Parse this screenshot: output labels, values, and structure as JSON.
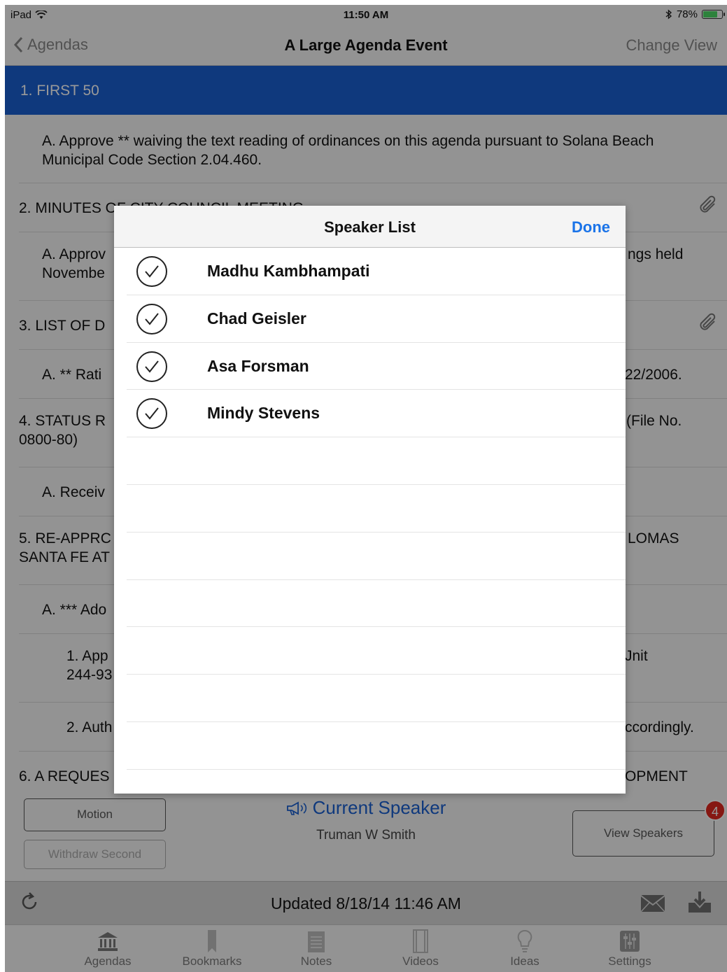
{
  "status_bar": {
    "device": "iPad",
    "time": "11:50 AM",
    "battery": "78%",
    "battery_level": 0.78
  },
  "nav": {
    "back_label": "Agendas",
    "title": "A Large Agenda Event",
    "right_label": "Change View"
  },
  "agenda": {
    "section": "1. FIRST 50",
    "rows": [
      {
        "text": "A. Approve ** waiving the text reading of ordinances on this agenda pursuant to Solana Beach Municipal Code Section 2.04.460."
      },
      {
        "text": "2. MINUTES OF CITY COUNCIL MEETING"
      },
      {
        "text": "A. Approv",
        "text_right": "ngs held",
        "text2": "Novembe"
      },
      {
        "text": "3. LIST OF D"
      },
      {
        "text": "A.  ** Rati",
        "text_right": "22/2006."
      },
      {
        "text": "4. STATUS R",
        "text_right": "(File No.",
        "text2": "0800-80)"
      },
      {
        "text": "A. Receiv"
      },
      {
        "text": "5. RE-APPRC",
        "text_right": "LOMAS",
        "text2": "SANTA FE AT"
      },
      {
        "text": "A. *** Ado"
      },
      {
        "text": "1. App",
        "text_right": "Jnit",
        "text2": "244-93"
      },
      {
        "text": "2. Auth",
        "text_right": "ccordingly."
      },
      {
        "text": "6. A REQUES",
        "text_right": "OPMENT"
      }
    ]
  },
  "speaker_panel": {
    "motion_label": "Motion",
    "withdraw_label": "Withdraw Second",
    "current_speaker_label": "Current Speaker",
    "current_speaker_name": "Truman W Smith",
    "view_speakers_label": "View Speakers",
    "badge_count": "4"
  },
  "update_bar": {
    "text": "Updated 8/18/14 11:46 AM"
  },
  "tabs": [
    "Agendas",
    "Bookmarks",
    "Notes",
    "Videos",
    "Ideas",
    "Settings"
  ],
  "modal": {
    "title": "Speaker List",
    "done_label": "Done",
    "speakers": [
      "Madhu Kambhampati",
      "Chad Geisler",
      "Asa Forsman",
      "Mindy Stevens"
    ]
  },
  "colors": {
    "accent": "#1a5fd0",
    "done": "#1a73e8",
    "badge": "#e0271e"
  }
}
